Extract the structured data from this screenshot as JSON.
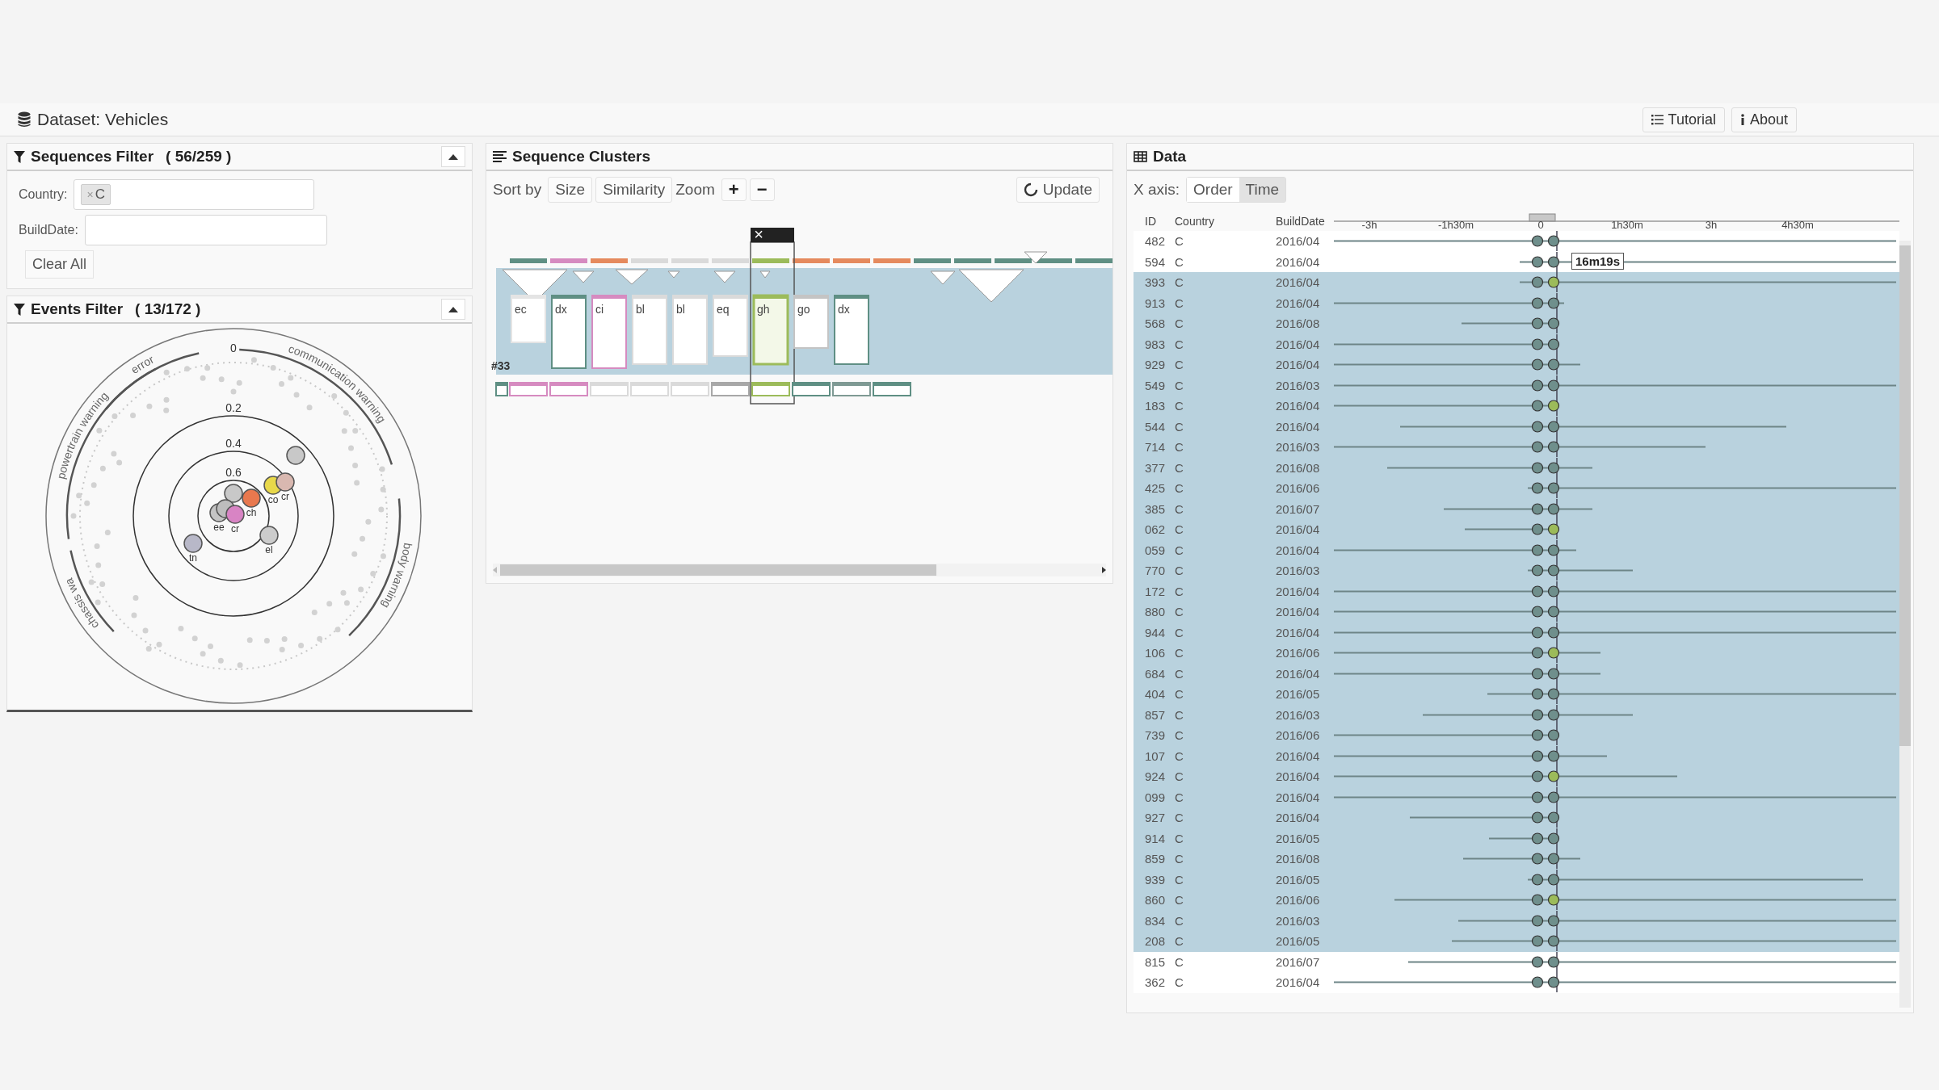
{
  "header": {
    "title": "Dataset: Vehicles",
    "buttons": [
      {
        "kind": "list",
        "label": "Tutorial"
      },
      {
        "kind": "info",
        "label": "About"
      }
    ]
  },
  "sequences_filter": {
    "title": "Sequences Filter",
    "count": "( 56/259 )",
    "country": {
      "label": "Country:",
      "tags": [
        {
          "remove": "×",
          "label": "C"
        }
      ]
    },
    "build_date": {
      "label": "BuildDate:"
    },
    "clear_button": "Clear All"
  },
  "events_filter": {
    "title": "Events Filter",
    "count": "( 13/172 )",
    "categories": [
      {
        "label": "error"
      },
      {
        "label": "communication warning"
      },
      {
        "label": "body warning"
      },
      {
        "label": "powertrain warning"
      },
      {
        "label": "chassis wa"
      }
    ],
    "rings": [
      "0",
      "0.2",
      "0.4",
      "0.6"
    ],
    "nodes": [
      {
        "color": "#c8c8c8"
      },
      {
        "color": "#e8d84a",
        "label": "co"
      },
      {
        "color": "#d9b8b0",
        "label": "cr"
      },
      {
        "color": "#e8784e",
        "label": "ch"
      },
      {
        "color": "#c8c8c8"
      },
      {
        "color": "#c4c4c4",
        "label": "ee"
      },
      {
        "color": "#bdbdbd"
      },
      {
        "color": "#d884c4",
        "label": "cr"
      },
      {
        "color": "#b8b8c8",
        "label": "tn"
      },
      {
        "color": "#cccccc",
        "label": "el"
      }
    ]
  },
  "sequence_clusters": {
    "title": "Sequence Clusters",
    "sort_label": "Sort by",
    "sort_buttons": [
      "Size",
      "Similarity"
    ],
    "zoom_label": "Zoom",
    "zoom_buttons": [
      "+",
      "−"
    ],
    "update_button": "Update",
    "close": "×",
    "cluster": {
      "label": "#33",
      "top_strip": [
        {
          "color": "#5f8f84"
        },
        {
          "color": "#d68bc0"
        },
        {
          "color": "#e58a5e"
        },
        {
          "color": "#dadada"
        },
        {
          "color": "#dadada"
        },
        {
          "color": "#dadada"
        },
        {
          "color": "#9cbb5a"
        },
        {
          "color": "#e58a5e"
        },
        {
          "color": "#e58a5e"
        },
        {
          "color": "#e58a5e"
        },
        {
          "color": "#5f8f84"
        },
        {
          "color": "#5f8f84"
        },
        {
          "color": "#5f8f84"
        },
        {
          "color": "#5f8f84"
        },
        {
          "color": "#5f8f84"
        }
      ],
      "events": [
        {
          "label": "ec",
          "color": "#e4e4e4",
          "selected": false
        },
        {
          "label": "dx",
          "color": "#5f8f84",
          "selected": false
        },
        {
          "label": "ci",
          "color": "#d68bc0",
          "selected": false
        },
        {
          "label": "bl",
          "color": "#dadada",
          "selected": false
        },
        {
          "label": "bl",
          "color": "#dadada",
          "selected": false
        },
        {
          "label": "eq",
          "color": "#dadada",
          "selected": false
        },
        {
          "label": "gh",
          "color": "#9cbb5a",
          "selected": true
        },
        {
          "label": "go",
          "color": "#c4c4c4",
          "selected": false
        },
        {
          "label": "dx",
          "color": "#5f8f84",
          "selected": false
        }
      ],
      "bottom_strip": [
        {
          "color": "#5f8f84"
        },
        {
          "color": "#d68bc0"
        },
        {
          "color": "#d68bc0"
        },
        {
          "color": "#dadada"
        },
        {
          "color": "#dadada"
        },
        {
          "color": "#dadada"
        },
        {
          "color": "#a8a8a8"
        },
        {
          "color": "#9cbb5a"
        },
        {
          "color": "#5f8f84"
        },
        {
          "color": "#7f9a94"
        },
        {
          "color": "#5f8f84"
        }
      ]
    }
  },
  "data": {
    "title": "Data",
    "x_axis_label": "X axis:",
    "x_axis_options": [
      {
        "label": "Order",
        "selected": false
      },
      {
        "label": "Time",
        "selected": true
      }
    ],
    "columns": [
      "ID",
      "Country",
      "BuildDate"
    ],
    "axis_ticks": [
      "-3h",
      "-1h30m",
      "0",
      "1h30m",
      "3h",
      "4h30m"
    ],
    "rows": [
      {
        "id": "482",
        "country": "C",
        "build_date": "2016/04",
        "selected": false
      },
      {
        "id": "594",
        "country": "C",
        "build_date": "2016/04",
        "selected": false,
        "tooltip": "16m19s"
      },
      {
        "id": "393",
        "country": "C",
        "build_date": "2016/04",
        "selected": true
      },
      {
        "id": "913",
        "country": "C",
        "build_date": "2016/04",
        "selected": true
      },
      {
        "id": "568",
        "country": "C",
        "build_date": "2016/08",
        "selected": true
      },
      {
        "id": "983",
        "country": "C",
        "build_date": "2016/04",
        "selected": true
      },
      {
        "id": "929",
        "country": "C",
        "build_date": "2016/04",
        "selected": true
      },
      {
        "id": "549",
        "country": "C",
        "build_date": "2016/03",
        "selected": true
      },
      {
        "id": "183",
        "country": "C",
        "build_date": "2016/04",
        "selected": true
      },
      {
        "id": "544",
        "country": "C",
        "build_date": "2016/04",
        "selected": true
      },
      {
        "id": "714",
        "country": "C",
        "build_date": "2016/03",
        "selected": true
      },
      {
        "id": "377",
        "country": "C",
        "build_date": "2016/08",
        "selected": true
      },
      {
        "id": "425",
        "country": "C",
        "build_date": "2016/06",
        "selected": true
      },
      {
        "id": "385",
        "country": "C",
        "build_date": "2016/07",
        "selected": true
      },
      {
        "id": "062",
        "country": "C",
        "build_date": "2016/04",
        "selected": true
      },
      {
        "id": "059",
        "country": "C",
        "build_date": "2016/04",
        "selected": true
      },
      {
        "id": "770",
        "country": "C",
        "build_date": "2016/03",
        "selected": true
      },
      {
        "id": "172",
        "country": "C",
        "build_date": "2016/04",
        "selected": true
      },
      {
        "id": "880",
        "country": "C",
        "build_date": "2016/04",
        "selected": true
      },
      {
        "id": "944",
        "country": "C",
        "build_date": "2016/04",
        "selected": true
      },
      {
        "id": "106",
        "country": "C",
        "build_date": "2016/06",
        "selected": true
      },
      {
        "id": "684",
        "country": "C",
        "build_date": "2016/04",
        "selected": true
      },
      {
        "id": "404",
        "country": "C",
        "build_date": "2016/05",
        "selected": true
      },
      {
        "id": "857",
        "country": "C",
        "build_date": "2016/03",
        "selected": true
      },
      {
        "id": "739",
        "country": "C",
        "build_date": "2016/06",
        "selected": true
      },
      {
        "id": "107",
        "country": "C",
        "build_date": "2016/04",
        "selected": true
      },
      {
        "id": "924",
        "country": "C",
        "build_date": "2016/04",
        "selected": true
      },
      {
        "id": "099",
        "country": "C",
        "build_date": "2016/04",
        "selected": true
      },
      {
        "id": "927",
        "country": "C",
        "build_date": "2016/04",
        "selected": true
      },
      {
        "id": "914",
        "country": "C",
        "build_date": "2016/05",
        "selected": true
      },
      {
        "id": "859",
        "country": "C",
        "build_date": "2016/08",
        "selected": true
      },
      {
        "id": "939",
        "country": "C",
        "build_date": "2016/05",
        "selected": true
      },
      {
        "id": "860",
        "country": "C",
        "build_date": "2016/06",
        "selected": true
      },
      {
        "id": "834",
        "country": "C",
        "build_date": "2016/03",
        "selected": true
      },
      {
        "id": "208",
        "country": "C",
        "build_date": "2016/05",
        "selected": true
      },
      {
        "id": "815",
        "country": "C",
        "build_date": "2016/07",
        "selected": false
      },
      {
        "id": "362",
        "country": "C",
        "build_date": "2016/04",
        "selected": false
      }
    ]
  }
}
